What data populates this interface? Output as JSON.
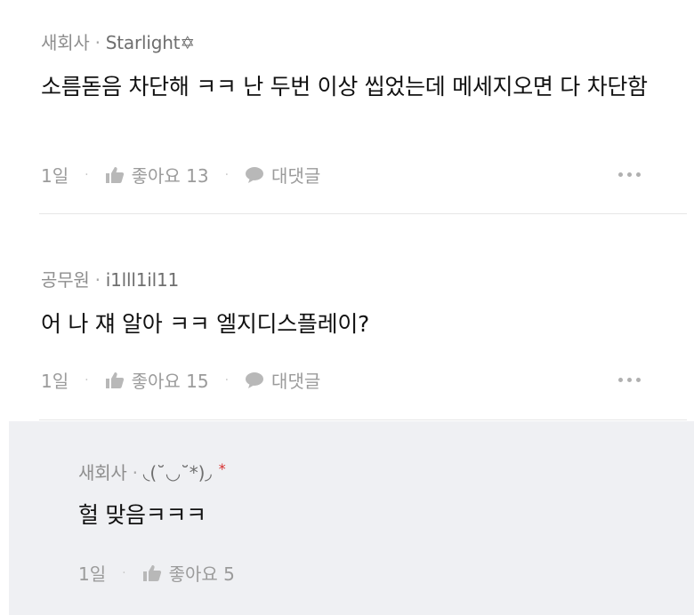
{
  "comments": [
    {
      "author_label": "새회사",
      "author_name": "Starlight✡",
      "text": "소름돋음 차단해 ㅋㅋ 난 두번 이상 씹었는데 메세지오면 다 차단함",
      "time": "1일",
      "like_label": "좋아요 13",
      "reply_label": "대댓글"
    },
    {
      "author_label": "공무원",
      "author_name": "i1lll1il11",
      "text": "어 나 쟤 알아 ㅋㅋ 엘지디스플레이?",
      "time": "1일",
      "like_label": "좋아요 15",
      "reply_label": "대댓글"
    },
    {
      "author_label": "새회사",
      "author_name": "◟(˘◡˘*)◞",
      "author_badge": "*",
      "text": "헐 맞음ㅋㅋㅋ",
      "time": "1일",
      "like_label": "좋아요 5"
    }
  ],
  "separator": "·",
  "icons": {
    "like": "thumbs-up-icon",
    "reply": "speech-bubble-icon",
    "more": "more-dots-icon"
  },
  "colors": {
    "meta_text": "#8e8e8e",
    "reply_background": "#eff0f3",
    "badge_red": "#d62d2d"
  }
}
